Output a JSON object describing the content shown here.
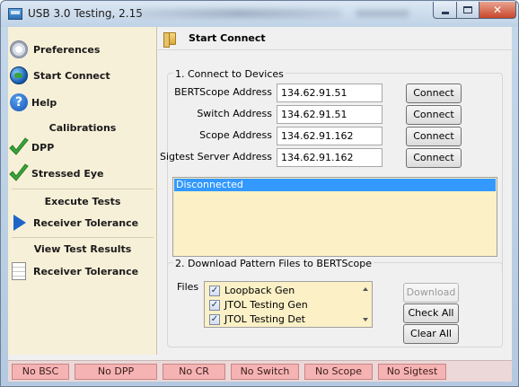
{
  "window": {
    "title": "USB 3.0 Testing, 2.15"
  },
  "sidebar": {
    "items": [
      {
        "label": "Preferences",
        "icon": "gear-icon"
      },
      {
        "label": "Start Connect",
        "icon": "globe-icon"
      },
      {
        "label": "Help",
        "icon": "help-icon"
      }
    ],
    "calibrations": {
      "heading": "Calibrations",
      "items": [
        {
          "label": "DPP",
          "icon": "checkmark-icon"
        },
        {
          "label": "Stressed Eye",
          "icon": "checkmark-icon"
        }
      ]
    },
    "execute": {
      "heading": "Execute Tests",
      "items": [
        {
          "label": "Receiver Tolerance",
          "icon": "play-arrow-icon"
        }
      ]
    },
    "results": {
      "heading": "View Test Results",
      "items": [
        {
          "label": "Receiver Tolerance",
          "icon": "document-icon"
        }
      ]
    }
  },
  "main": {
    "title": "Start Connect",
    "connect": {
      "heading": "1. Connect to Devices",
      "rows": [
        {
          "label": "BERTScope Address",
          "value": "134.62.91.51",
          "button": "Connect"
        },
        {
          "label": "Switch Address",
          "value": "134.62.91.51",
          "button": "Connect"
        },
        {
          "label": "Scope Address",
          "value": "134.62.91.162",
          "button": "Connect"
        },
        {
          "label": "Sigtest Server Address",
          "value": "134.62.91.162",
          "button": "Connect"
        }
      ],
      "status_text": "Disconnected"
    },
    "download": {
      "heading": "2. Download Pattern Files to BERTScope",
      "files_label": "Files",
      "files": [
        {
          "label": "Loopback Gen",
          "checked": true
        },
        {
          "label": "JTOL Testing Gen",
          "checked": true
        },
        {
          "label": "JTOL Testing Det",
          "checked": true
        }
      ],
      "download_button": "Download",
      "check_all_button": "Check All",
      "clear_all_button": "Clear All"
    }
  },
  "statusbar": {
    "items": [
      "No BSC",
      "No DPP",
      "No CR",
      "No Switch",
      "No Scope",
      "No Sigtest"
    ]
  },
  "colors": {
    "sidebar_bg": "#f7f0d8",
    "status_box_bg": "#fbf0c6",
    "selection_blue": "#3399ff",
    "status_pill": "#f6b3b3"
  }
}
